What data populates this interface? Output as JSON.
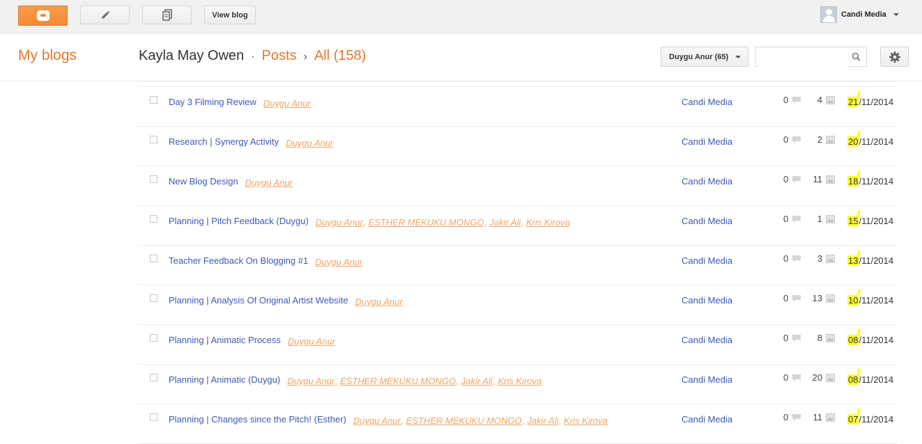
{
  "toolbar": {
    "view_blog_label": "View blog",
    "user_name": "Candi Media"
  },
  "header": {
    "my_blogs": "My blogs",
    "blog_title": "Kayla May Owen",
    "separator_dot": "·",
    "posts": "Posts",
    "separator_arrow": "›",
    "all": "All (158)",
    "filter_label": "Duygu Anur (65)",
    "search_value": ""
  },
  "colors": {
    "accent_orange": "#e8762c",
    "link_blue": "#3a59b4",
    "label_orange": "#f0a463",
    "highlight_yellow": "#ffff2e"
  },
  "posts": [
    {
      "title": "Day 3 Filming Review",
      "labels": [
        "Duygu Anur"
      ],
      "author": "Candi Media",
      "comments": "0",
      "views": "4",
      "date_day": "21",
      "date_rest": "/11/2014"
    },
    {
      "title": "Research | Synergy Activity",
      "labels": [
        "Duygu Anur"
      ],
      "author": "Candi Media",
      "comments": "0",
      "views": "2",
      "date_day": "20",
      "date_rest": "/11/2014"
    },
    {
      "title": "New Blog Design",
      "labels": [
        "Duygu Anur"
      ],
      "author": "Candi Media",
      "comments": "0",
      "views": "11",
      "date_day": "18",
      "date_rest": "/11/2014"
    },
    {
      "title": "Planning | Pitch Feedback (Duygu)",
      "labels": [
        "Duygu Anur",
        "ESTHER MEKUKU MONGO",
        "Jakir Ali",
        "Kris Kirova"
      ],
      "author": "Candi Media",
      "comments": "0",
      "views": "1",
      "date_day": "15",
      "date_rest": "/11/2014"
    },
    {
      "title": "Teacher Feedback On Blogging #1",
      "labels": [
        "Duygu Anur"
      ],
      "author": "Candi Media",
      "comments": "0",
      "views": "3",
      "date_day": "13",
      "date_rest": "/11/2014"
    },
    {
      "title": "Planning | Analysis Of Original Artist Website",
      "labels": [
        "Duygu Anur"
      ],
      "author": "Candi Media",
      "comments": "0",
      "views": "13",
      "date_day": "10",
      "date_rest": "/11/2014"
    },
    {
      "title": "Planning | Animatic Process",
      "labels": [
        "Duygu Anur"
      ],
      "author": "Candi Media",
      "comments": "0",
      "views": "8",
      "date_day": "08",
      "date_rest": "/11/2014"
    },
    {
      "title": "Planning | Animatic (Duygu)",
      "labels": [
        "Duygu Anur",
        "ESTHER MEKUKU MONGO",
        "Jakir Ali",
        "Kris Kirova"
      ],
      "author": "Candi Media",
      "comments": "0",
      "views": "20",
      "date_day": "08",
      "date_rest": "/11/2014"
    },
    {
      "title": "Planning | Changes since the Pitch! (Esther)",
      "labels": [
        "Duygu Anur",
        "ESTHER MEKUKU MONGO",
        "Jakir Ali",
        "Kris Kirova"
      ],
      "author": "Candi Media",
      "comments": "0",
      "views": "11",
      "date_day": "07",
      "date_rest": "/11/2014"
    }
  ]
}
